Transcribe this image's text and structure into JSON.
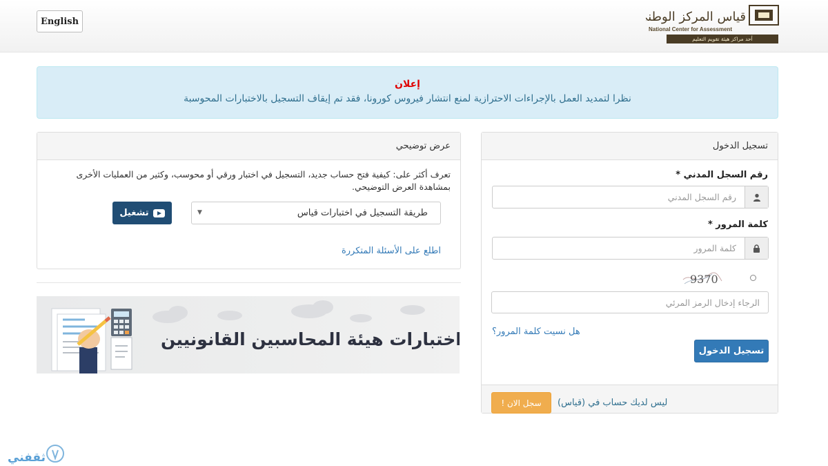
{
  "header": {
    "lang_button": "English",
    "logo": {
      "ar": "قياس المركز الوطني للقياس",
      "en": "National Center for Assessment",
      "sub": "أحد مراكز هيئة تقويم التعليم"
    }
  },
  "announcement": {
    "title": "إعلان",
    "text": "نظرا لتمديد العمل بالإجراءات الاحترازية لمنع انتشار فيروس كورونا، فقد تم إيقاف التسجيل بالاختبارات المحوسبة"
  },
  "demo": {
    "title": "عرض توضيحي",
    "description": "تعرف أكثر على: كيفية فتح حساب جديد، التسجيل في اختبار ورقي أو محوسب، وكثير من العمليات الأخرى بمشاهدة العرض التوضيحي.",
    "select_value": "طريقة التسجيل في اختبارات قياس",
    "play_label": "تشغيل",
    "faq_link": "اطلع على الأسئلة المتكررة"
  },
  "banner": {
    "text": "اختبارات هيئة المحاسبين القانونيين"
  },
  "login": {
    "title": "تسجيل الدخول",
    "id_label": "رقم السجل المدني *",
    "id_placeholder": "رقم السجل المدني",
    "password_label": "كلمة المرور *",
    "password_placeholder": "كلمة المرور",
    "captcha_code": "9370",
    "captcha_placeholder": "الرجاء إدخال الرمز المرئي",
    "forgot_link": "هل نسيت كلمة المرور؟",
    "submit_label": "تسجيل الدخول",
    "no_account_text": "ليس لديك حساب في (قياس)",
    "register_label": "سجل الان !"
  },
  "watermark": {
    "text": "ثقفني"
  },
  "colors": {
    "primary": "#337ab7",
    "dark_button": "#204d74",
    "warning": "#f0ad4e",
    "alert_bg": "#d9edf7",
    "alert_title": "#e00000"
  }
}
